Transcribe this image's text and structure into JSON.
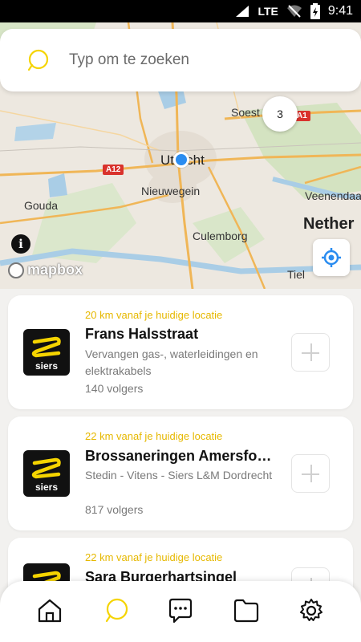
{
  "status_bar": {
    "network": "LTE",
    "time": "9:41"
  },
  "search": {
    "placeholder": "Typ om te zoeken"
  },
  "map": {
    "labels": [
      "Soest",
      "Utrecht",
      "Gouda",
      "Nieuwegein",
      "Veenendaal",
      "Nether",
      "Culemborg",
      "Tiel"
    ],
    "road_badges": [
      "A12",
      "A1"
    ],
    "cluster_count": "3",
    "attribution": "mapbox"
  },
  "cards": [
    {
      "distance": "20 km vanaf je huidige locatie",
      "name": "Frans Halsstraat",
      "description": "Vervangen gas-, waterleidingen en elektrakabels",
      "followers": "140 volgers",
      "logo_text": "siers"
    },
    {
      "distance": "22 km vanaf je huidige locatie",
      "name": "Brossaneringen Amersfo…",
      "description": "Stedin - Vitens - Siers L&M Dordrecht",
      "followers": "817 volgers",
      "logo_text": "siers"
    },
    {
      "distance": "22 km vanaf je huidige locatie",
      "name": "Sara Burgerhartsingel",
      "description": "",
      "followers": "",
      "logo_text": "siers"
    }
  ],
  "bottom_nav": [
    "home-icon",
    "search-icon",
    "chat-icon",
    "folder-icon",
    "gear-icon"
  ],
  "colors": {
    "accent": "#f5d400",
    "distance": "#e6b800",
    "user_dot": "#2a8cf0"
  }
}
